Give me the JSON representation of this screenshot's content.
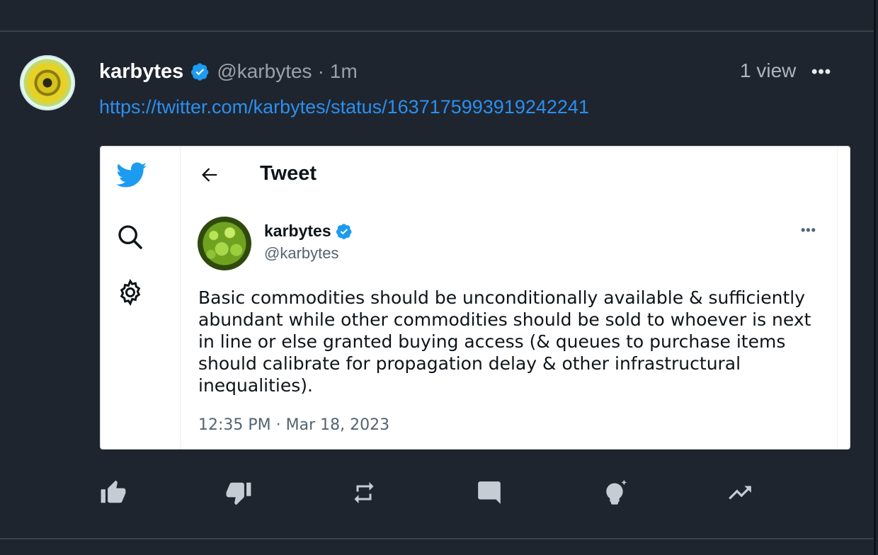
{
  "post": {
    "author_name": "karbytes",
    "author_handle": "@karbytes",
    "separator": "·",
    "time_ago": "1m",
    "views": "1 view",
    "more": "•••",
    "link_text": "https://twitter.com/karbytes/status/1637175993919242241"
  },
  "embedded_tweet": {
    "page_title": "Tweet",
    "author_name": "karbytes",
    "author_handle": "@karbytes",
    "more": "•••",
    "body": "Basic commodities should be unconditionally available  & sufficiently abundant while other commodities should be sold to whoever is next in line or else granted buying access (& queues to purchase items should calibrate for propagation delay & other infrastructural inequalities).",
    "timestamp": "12:35 PM · Mar 18, 2023",
    "sidebar_icons": [
      "twitter-bird-icon",
      "search-icon",
      "gear-icon"
    ]
  },
  "actions": [
    {
      "name": "like-button",
      "icon": "thumbs-up-icon"
    },
    {
      "name": "dislike-button",
      "icon": "thumbs-down-icon"
    },
    {
      "name": "repost-button",
      "icon": "repost-icon"
    },
    {
      "name": "comment-button",
      "icon": "comment-icon"
    },
    {
      "name": "insight-button",
      "icon": "lightbulb-sparkle-icon"
    },
    {
      "name": "trending-button",
      "icon": "trending-icon"
    }
  ],
  "colors": {
    "background": "#1f252e",
    "link": "#2b8ff0",
    "verified": "#1d9bf0",
    "icon": "#c6ccd4"
  }
}
